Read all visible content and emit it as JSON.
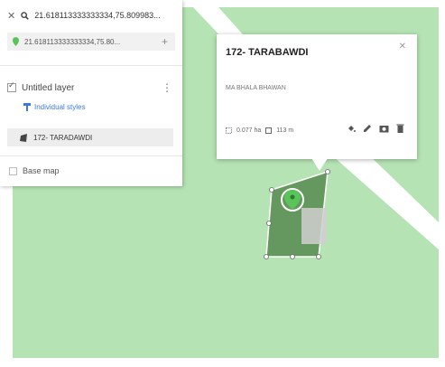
{
  "search": {
    "query": "21.618113333333334,75.809983...",
    "subtitle": "21.618113333333334,75.80..."
  },
  "layer": {
    "title": "Untitled layer",
    "styles_link": "Individual styles",
    "feature_name": "172- TARADAWDI"
  },
  "base_map": {
    "label": "Base map"
  },
  "popup": {
    "title": "172- TARABAWDI",
    "description": "MA BHALA BHAWAN",
    "area": "0.077 ha",
    "perimeter": "113 m"
  },
  "colors": {
    "map_background": "#b5e3b3",
    "polygon_fill": "#5b8f55",
    "pin": "#5ac35a",
    "link": "#3b78e7"
  },
  "icons": [
    "close-icon",
    "search-icon",
    "pin-icon",
    "add-icon",
    "more-vert-icon",
    "style-icon",
    "polygon-icon",
    "paint-icon",
    "edit-icon",
    "camera-icon",
    "delete-icon"
  ]
}
